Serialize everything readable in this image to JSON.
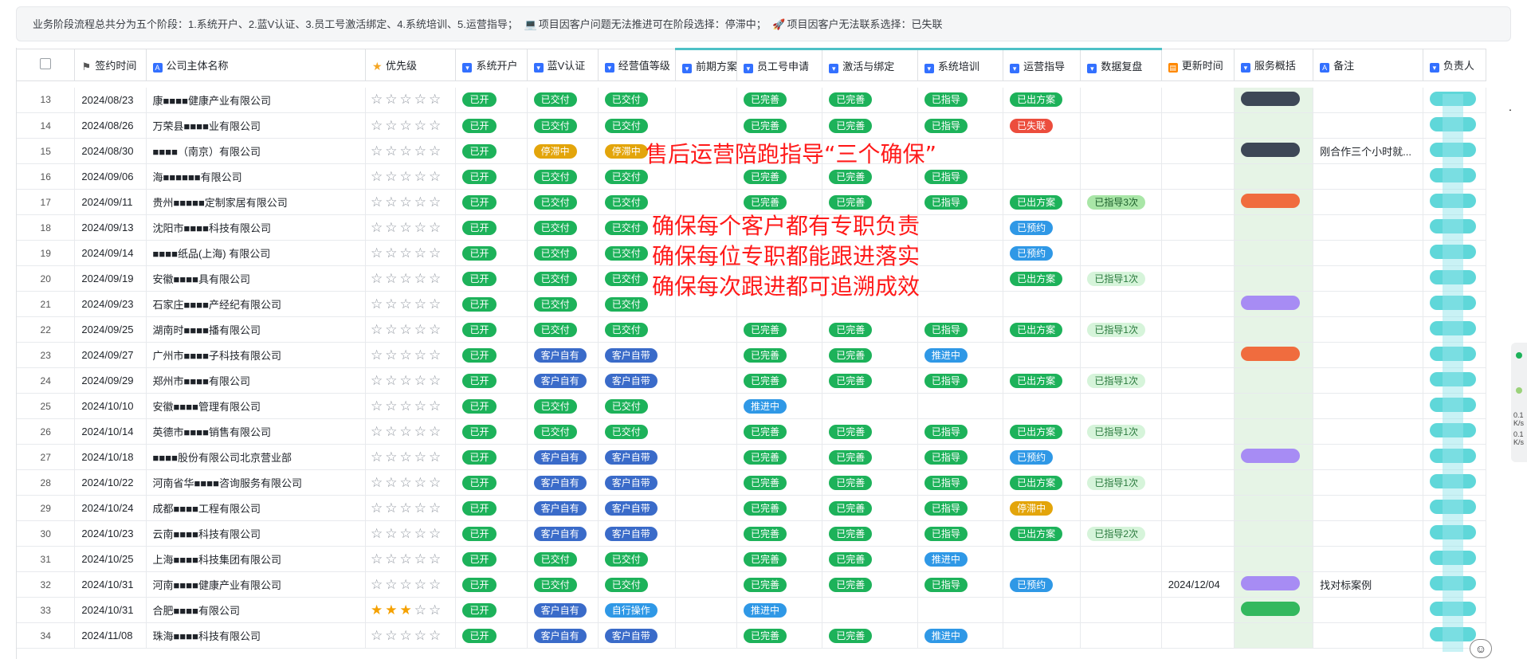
{
  "banner": {
    "text1": "业务阶段流程总共分为五个阶段：1.系统开户、2.蓝V认证、3.员工号激活绑定、4.系统培训、5.运营指导；",
    "text2": "项目因客户问题无法推进可在阶段选择：停滞中；",
    "text3": "项目因客户无法联系选择：已失联"
  },
  "columns": [
    "签约时间",
    "公司主体名称",
    "优先级",
    "系统开户",
    "蓝V认证",
    "经营值等级",
    "前期方案",
    "员工号申请",
    "激活与绑定",
    "系统培训",
    "运营指导",
    "数据复盘",
    "更新时间",
    "服务概括",
    "备注",
    "负责人"
  ],
  "add_column": "+",
  "overlay": {
    "title": "售后运营陪跑指导“三个确保”",
    "line1": "确保每个客户都有专职负责",
    "line2": "确保每位专职都能跟进落实",
    "line3": "确保每次跟进都可追溯成效"
  },
  "rightbar": {
    "v1": "0.1",
    "u1": "K/s",
    "v2": "0.1",
    "u2": "K/s"
  },
  "rows": [
    {
      "n": "13",
      "date": "2024/08/23",
      "company": "康■■■■健康产业有限公司",
      "stars": 0,
      "kh": "已开",
      "lv": "已交付",
      "jy": "已交付",
      "yg": "已完善",
      "jh": "已完善",
      "px": "已指导",
      "yy": "已出方案",
      "fp": "",
      "upd": "",
      "sv": "dark",
      "note": ""
    },
    {
      "n": "14",
      "date": "2024/08/26",
      "company": "万荣县■■■■业有限公司",
      "stars": 0,
      "kh": "已开",
      "lv": "已交付",
      "jy": "已交付",
      "yg": "已完善",
      "jh": "已完善",
      "px": "已指导",
      "yy": "已失联",
      "fp": "",
      "upd": "",
      "sv": "",
      "note": ""
    },
    {
      "n": "15",
      "date": "2024/08/30",
      "company": "■■■■（南京）有限公司",
      "stars": 0,
      "kh": "已开",
      "lv": "停滞中",
      "jy": "停滞中",
      "yg": "",
      "jh": "",
      "px": "",
      "yy": "",
      "fp": "",
      "upd": "",
      "sv": "dark",
      "note": "刚合作三个小时就..."
    },
    {
      "n": "16",
      "date": "2024/09/06",
      "company": "海■■■■■■有限公司",
      "stars": 0,
      "kh": "已开",
      "lv": "已交付",
      "jy": "已交付",
      "yg": "已完善",
      "jh": "已完善",
      "px": "已指导",
      "yy": "",
      "fp": "",
      "upd": "",
      "sv": "",
      "note": ""
    },
    {
      "n": "17",
      "date": "2024/09/11",
      "company": "贵州■■■■■定制家居有限公司",
      "stars": 0,
      "kh": "已开",
      "lv": "已交付",
      "jy": "已交付",
      "yg": "已完善",
      "jh": "已完善",
      "px": "已指导",
      "yy": "已出方案",
      "fp": "已指导3次",
      "upd": "",
      "sv": "orange",
      "note": ""
    },
    {
      "n": "18",
      "date": "2024/09/13",
      "company": "沈阳市■■■■科技有限公司",
      "stars": 0,
      "kh": "已开",
      "lv": "已交付",
      "jy": "已交付",
      "yg": "",
      "jh": "",
      "px": "",
      "yy": "已预约",
      "fp": "",
      "upd": "",
      "sv": "",
      "note": ""
    },
    {
      "n": "19",
      "date": "2024/09/14",
      "company": "■■■■纸品(上海) 有限公司",
      "stars": 0,
      "kh": "已开",
      "lv": "已交付",
      "jy": "已交付",
      "yg": "",
      "jh": "",
      "px": "",
      "yy": "已预约",
      "fp": "",
      "upd": "",
      "sv": "",
      "note": ""
    },
    {
      "n": "20",
      "date": "2024/09/19",
      "company": "安徽■■■■具有限公司",
      "stars": 0,
      "kh": "已开",
      "lv": "已交付",
      "jy": "已交付",
      "yg": "",
      "jh": "",
      "px": "",
      "yy": "已出方案",
      "fp": "已指导1次",
      "upd": "",
      "sv": "",
      "note": ""
    },
    {
      "n": "21",
      "date": "2024/09/23",
      "company": "石家庄■■■■产经纪有限公司",
      "stars": 0,
      "kh": "已开",
      "lv": "已交付",
      "jy": "已交付",
      "yg": "",
      "jh": "",
      "px": "",
      "yy": "",
      "fp": "",
      "upd": "",
      "sv": "purple",
      "note": ""
    },
    {
      "n": "22",
      "date": "2024/09/25",
      "company": "湖南时■■■■播有限公司",
      "stars": 0,
      "kh": "已开",
      "lv": "已交付",
      "jy": "已交付",
      "yg": "已完善",
      "jh": "已完善",
      "px": "已指导",
      "yy": "已出方案",
      "fp": "已指导1次",
      "upd": "",
      "sv": "",
      "note": ""
    },
    {
      "n": "23",
      "date": "2024/09/27",
      "company": "广州市■■■■子科技有限公司",
      "stars": 0,
      "kh": "已开",
      "lv": "客户自有",
      "jy": "客户自带",
      "yg": "已完善",
      "jh": "已完善",
      "px": "推进中",
      "yy": "",
      "fp": "",
      "upd": "",
      "sv": "orange",
      "note": ""
    },
    {
      "n": "24",
      "date": "2024/09/29",
      "company": "郑州市■■■■有限公司",
      "stars": 0,
      "kh": "已开",
      "lv": "客户自有",
      "jy": "客户自带",
      "yg": "已完善",
      "jh": "已完善",
      "px": "已指导",
      "yy": "已出方案",
      "fp": "已指导1次",
      "upd": "",
      "sv": "",
      "note": ""
    },
    {
      "n": "25",
      "date": "2024/10/10",
      "company": "安徽■■■■管理有限公司",
      "stars": 0,
      "kh": "已开",
      "lv": "已交付",
      "jy": "已交付",
      "yg": "推进中",
      "jh": "",
      "px": "",
      "yy": "",
      "fp": "",
      "upd": "",
      "sv": "",
      "note": ""
    },
    {
      "n": "26",
      "date": "2024/10/14",
      "company": "英德市■■■■销售有限公司",
      "stars": 0,
      "kh": "已开",
      "lv": "已交付",
      "jy": "已交付",
      "yg": "已完善",
      "jh": "已完善",
      "px": "已指导",
      "yy": "已出方案",
      "fp": "已指导1次",
      "upd": "",
      "sv": "",
      "note": ""
    },
    {
      "n": "27",
      "date": "2024/10/18",
      "company": "■■■■股份有限公司北京营业部",
      "stars": 0,
      "kh": "已开",
      "lv": "客户自有",
      "jy": "客户自带",
      "yg": "已完善",
      "jh": "已完善",
      "px": "已指导",
      "yy": "已预约",
      "fp": "",
      "upd": "",
      "sv": "purple",
      "note": ""
    },
    {
      "n": "28",
      "date": "2024/10/22",
      "company": "河南省华■■■■咨询服务有限公司",
      "stars": 0,
      "kh": "已开",
      "lv": "客户自有",
      "jy": "客户自带",
      "yg": "已完善",
      "jh": "已完善",
      "px": "已指导",
      "yy": "已出方案",
      "fp": "已指导1次",
      "upd": "",
      "sv": "",
      "note": ""
    },
    {
      "n": "29",
      "date": "2024/10/24",
      "company": "成都■■■■工程有限公司",
      "stars": 0,
      "kh": "已开",
      "lv": "客户自有",
      "jy": "客户自带",
      "yg": "已完善",
      "jh": "已完善",
      "px": "已指导",
      "yy": "停滞中",
      "fp": "",
      "upd": "",
      "sv": "",
      "note": ""
    },
    {
      "n": "30",
      "date": "2024/10/23",
      "company": "云南■■■■科技有限公司",
      "stars": 0,
      "kh": "已开",
      "lv": "客户自有",
      "jy": "客户自带",
      "yg": "已完善",
      "jh": "已完善",
      "px": "已指导",
      "yy": "已出方案",
      "fp": "已指导2次",
      "upd": "",
      "sv": "",
      "note": ""
    },
    {
      "n": "31",
      "date": "2024/10/25",
      "company": "上海■■■■科技集团有限公司",
      "stars": 0,
      "kh": "已开",
      "lv": "已交付",
      "jy": "已交付",
      "yg": "已完善",
      "jh": "已完善",
      "px": "推进中",
      "yy": "",
      "fp": "",
      "upd": "",
      "sv": "",
      "note": ""
    },
    {
      "n": "32",
      "date": "2024/10/31",
      "company": "河南■■■■健康产业有限公司",
      "stars": 0,
      "kh": "已开",
      "lv": "已交付",
      "jy": "已交付",
      "yg": "已完善",
      "jh": "已完善",
      "px": "已指导",
      "yy": "已预约",
      "fp": "",
      "upd": "2024/12/04",
      "sv": "purple",
      "note": "找对标案例"
    },
    {
      "n": "33",
      "date": "2024/10/31",
      "company": "合肥■■■■有限公司",
      "stars": 3,
      "kh": "已开",
      "lv": "客户自有",
      "jy": "自行操作",
      "yg": "推进中",
      "jh": "",
      "px": "",
      "yy": "",
      "fp": "",
      "upd": "",
      "sv": "green",
      "note": ""
    },
    {
      "n": "34",
      "date": "2024/11/08",
      "company": "珠海■■■■科技有限公司",
      "stars": 0,
      "kh": "已开",
      "lv": "客户自有",
      "jy": "客户自带",
      "yg": "已完善",
      "jh": "已完善",
      "px": "推进中",
      "yy": "",
      "fp": "",
      "upd": "",
      "sv": "",
      "note": ""
    }
  ],
  "tag_colors": {
    "已开": "g",
    "已交付": "g",
    "已完善": "g",
    "已指导": "g",
    "已出方案": "g",
    "停滞中": "y",
    "客户自有": "b",
    "客户自带": "b",
    "自行操作": "lb",
    "推进中": "lb",
    "已预约": "lb",
    "已失联": "r",
    "已指导1次": "lg",
    "已指导2次": "lg",
    "已指导3次": "lg2"
  }
}
